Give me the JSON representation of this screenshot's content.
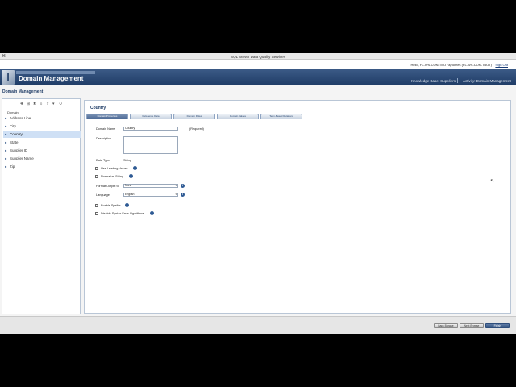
{
  "window": {
    "title": "SQL Server Data Quality Services",
    "app_icon": "⌘"
  },
  "user": {
    "hello": "Hello, FL-WS-CON-TBOT\\sjhomes (FL-WS-CON-TBOT)",
    "signout": "Sign Out"
  },
  "banner": {
    "title": "Domain Management",
    "knowledge_base": "Knowledge Base: Suppliers",
    "activity": "Activity: Domain Management"
  },
  "page": {
    "heading": "Domain Management"
  },
  "left": {
    "domains_label": "Domain",
    "items": [
      {
        "label": "Address Line"
      },
      {
        "label": "City"
      },
      {
        "label": "Country"
      },
      {
        "label": "State"
      },
      {
        "label": "Supplier ID"
      },
      {
        "label": "Supplier Name"
      },
      {
        "label": "Zip"
      }
    ]
  },
  "domain": {
    "title": "Country",
    "tabs": [
      "Domain Properties",
      "Reference Data",
      "Domain Rules",
      "Domain Values",
      "Term-Based Relations"
    ],
    "fields": {
      "name_label": "Domain Name",
      "name_value": "Country",
      "required": "(Required)",
      "description_label": "Description",
      "data_type_label": "Data Type",
      "data_type_value": "String",
      "use_leading_values": "Use Leading Values",
      "normalize_string": "Normalize String",
      "format_output_label": "Format Output to",
      "format_output_value": "None",
      "language_label": "Language",
      "language_value": "English",
      "enable_speller": "Enable Speller",
      "disable_syntax": "Disable Syntax Error Algorithms"
    }
  },
  "footer": {
    "back": "Back Browse",
    "next": "Next Browse",
    "finish": "Finish"
  }
}
